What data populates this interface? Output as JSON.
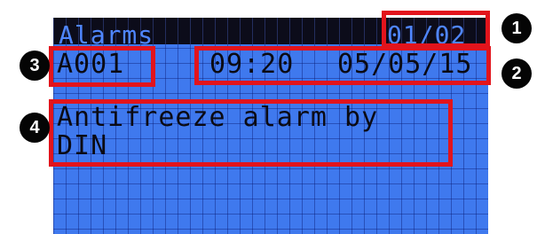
{
  "screen": {
    "title": "Alarms",
    "page_indicator": "01/02",
    "alarm_code": "A001",
    "time": "09:20",
    "date": "05/05/15",
    "description_line1": "Antifreeze alarm by",
    "description_line2": "DIN"
  },
  "callouts": [
    {
      "number": "1"
    },
    {
      "number": "2"
    },
    {
      "number": "3"
    },
    {
      "number": "4"
    }
  ],
  "colors": {
    "lcd_background": "#3f79ee",
    "lcd_titlebar": "#0c0c1a",
    "callout_border": "#e2141c",
    "badge_fill": "#050505"
  }
}
